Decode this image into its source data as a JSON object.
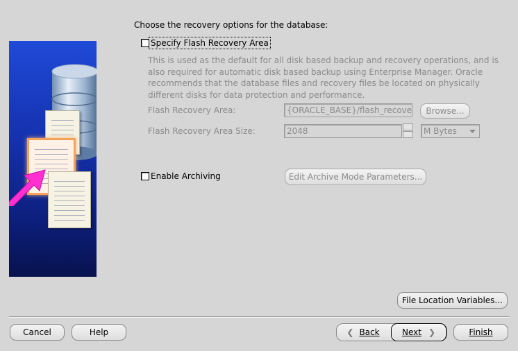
{
  "heading": "Choose the recovery options for the database:",
  "flash": {
    "checkbox_label": "Specify Flash Recovery Area",
    "checked": false,
    "description": "This is used as the default for all disk based backup and recovery operations, and is also required for automatic disk based backup using Enterprise Manager. Oracle recommends that the database files and recovery files be located on physically different disks for data protection and performance.",
    "area_label": "Flash Recovery Area:",
    "area_value": "{ORACLE_BASE}/flash_recovery_",
    "browse_label": "Browse...",
    "size_label": "Flash Recovery Area Size:",
    "size_value": "2048",
    "unit_value": "M Bytes"
  },
  "archiving": {
    "checkbox_label": "Enable Archiving",
    "checked": false,
    "edit_button_label": "Edit Archive Mode Parameters..."
  },
  "file_location_button_label": "File Location Variables...",
  "footer": {
    "cancel": "Cancel",
    "help": "Help",
    "back": "Back",
    "next": "Next",
    "finish": "Finish"
  },
  "colors": {
    "panel_bg": "#d6d6d6",
    "disabled_text": "#8a8a8a",
    "art_blue": "#1532b0",
    "arrow_magenta": "#ff2fd2",
    "highlight_orange": "#f5a15a"
  }
}
